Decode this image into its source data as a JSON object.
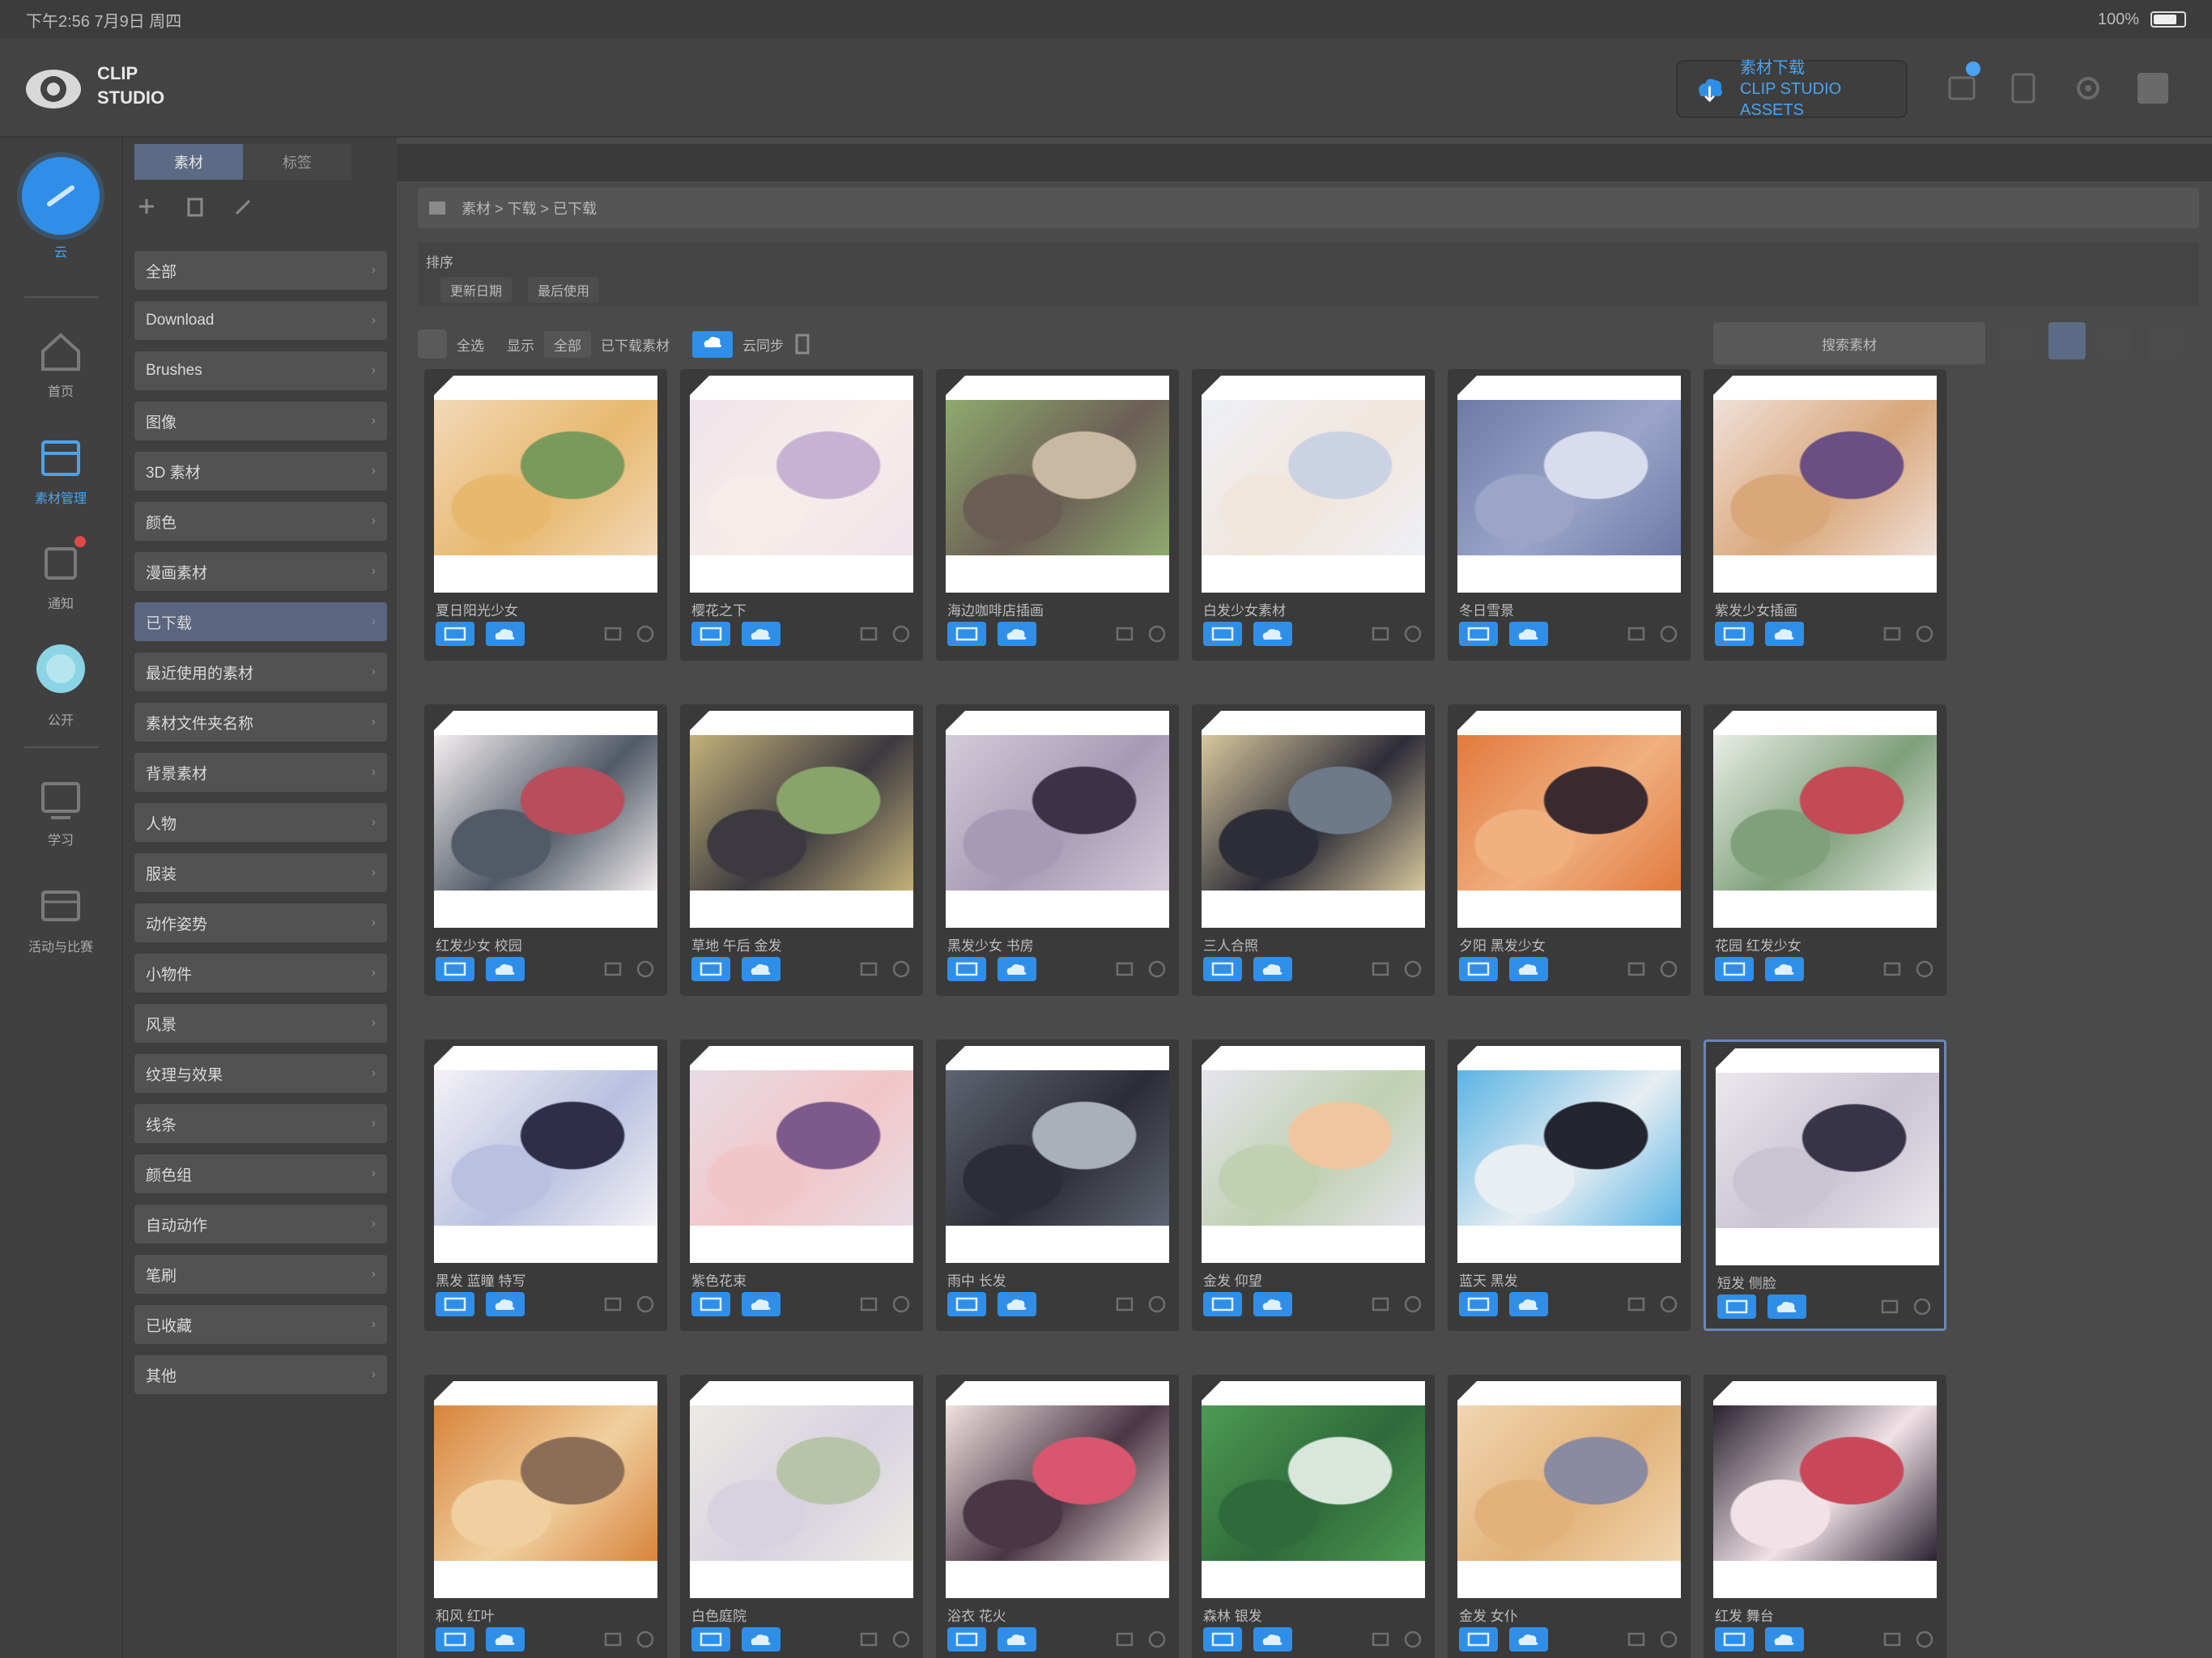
{
  "status_bar": {
    "left_text": "下午2:56 7月9日 周四",
    "right_text": "100%"
  },
  "header": {
    "logo_line1": "CLIP",
    "logo_line2": "STUDIO",
    "download_button": {
      "line1": "素材下载",
      "line2": "CLIP STUDIO ASSETS"
    }
  },
  "rail": {
    "items": [
      {
        "label": "云",
        "icon": "cloud-icon",
        "active": true
      },
      {
        "label": "首页",
        "icon": "home-icon",
        "active": false
      },
      {
        "label": "素材管理",
        "icon": "assets-icon",
        "active": true
      },
      {
        "label": "通知",
        "icon": "notification-icon",
        "active": false
      },
      {
        "label": "公开",
        "icon": "share-icon",
        "active": false
      },
      {
        "label": "学习",
        "icon": "learn-icon",
        "active": false
      },
      {
        "label": "活动与比赛",
        "icon": "event-icon",
        "active": false
      }
    ]
  },
  "category_panel": {
    "tabs": [
      "素材",
      "标签"
    ],
    "items": [
      "全部",
      "Download",
      "Brushes",
      "图像",
      "3D 素材",
      "颜色",
      "漫画素材",
      "已下载",
      "最近使用的素材",
      "素材文件夹名称",
      "背景素材",
      "人物",
      "服装",
      "动作姿势",
      "小物件",
      "风景",
      "纹理与效果",
      "线条",
      "颜色组",
      "自动动作",
      "笔刷",
      "已收藏",
      "其他"
    ],
    "selected_index": 7
  },
  "pathbar": {
    "text": "素材 > 下载 > 已下载"
  },
  "sortbar": {
    "label": "排序",
    "chips": [
      "更新日期",
      "最后使用"
    ]
  },
  "toolbar": {
    "select_all": "全选",
    "items": [
      "显示",
      "全部",
      "已下载素材"
    ],
    "cloud_label": "云同步",
    "search_placeholder": "搜索素材"
  },
  "cards": [
    {
      "title": "夏日阳光少女",
      "palette": [
        "#f2d9b8",
        "#7a9a5c",
        "#e8b86e"
      ]
    },
    {
      "title": "樱花之下",
      "palette": [
        "#efe4ea",
        "#c7b2d4",
        "#f6ece9"
      ]
    },
    {
      "title": "海边咖啡店插画",
      "palette": [
        "#8faa6e",
        "#c9b8a2",
        "#6b5f55"
      ]
    },
    {
      "title": "白发少女素材",
      "palette": [
        "#eef0f6",
        "#cbd2e4",
        "#f1e6dc"
      ]
    },
    {
      "title": "冬日雪景",
      "palette": [
        "#6c7aa6",
        "#d8dcec",
        "#9aa5c8"
      ]
    },
    {
      "title": "紫发少女插画",
      "palette": [
        "#f0e0d8",
        "#6b4f82",
        "#d9a77a"
      ]
    },
    {
      "title": "红发少女 校园",
      "palette": [
        "#f4eff0",
        "#b84d5c",
        "#515a66"
      ]
    },
    {
      "title": "草地 午后 金发",
      "palette": [
        "#c4b27a",
        "#88a46a",
        "#3c3a40"
      ]
    },
    {
      "title": "黑发少女 书房",
      "palette": [
        "#d3ccd8",
        "#3b3248",
        "#a79ab6"
      ]
    },
    {
      "title": "三人合照",
      "palette": [
        "#d8c89e",
        "#6e7a8a",
        "#2d2d38"
      ]
    },
    {
      "title": "夕阳 黑发少女",
      "palette": [
        "#e27a3e",
        "#3a2a30",
        "#f0b080"
      ]
    },
    {
      "title": "花园 红发少女",
      "palette": [
        "#e8ede6",
        "#c44a56",
        "#7fa07a"
      ]
    },
    {
      "title": "黑发 蓝瞳 特写",
      "palette": [
        "#f4f2f6",
        "#2e2e48",
        "#b9c0e0"
      ]
    },
    {
      "title": "紫色花束",
      "palette": [
        "#e8dce4",
        "#7e5a8c",
        "#f1c6c9"
      ]
    },
    {
      "title": "雨中 长发",
      "palette": [
        "#5e6470",
        "#aab0b8",
        "#2c2d36"
      ]
    },
    {
      "title": "金发 仰望",
      "palette": [
        "#e6e4ee",
        "#f0c6a0",
        "#c0d0b0"
      ]
    },
    {
      "title": "蓝天 黑发",
      "palette": [
        "#5ab4e4",
        "#232630",
        "#e8eef2"
      ]
    },
    {
      "title": "短发 侧脸",
      "palette": [
        "#eae8ec",
        "#383448",
        "#c9c3d2"
      ]
    },
    {
      "title": "和风 红叶",
      "palette": [
        "#d8843c",
        "#8c6e58",
        "#f0d0a0"
      ]
    },
    {
      "title": "白色庭院",
      "palette": [
        "#ecebe4",
        "#b8c4a8",
        "#d8d2e0"
      ]
    },
    {
      "title": "浴衣 花火",
      "palette": [
        "#f0e2e0",
        "#d9566e",
        "#4a3644"
      ]
    },
    {
      "title": "森林 银发",
      "palette": [
        "#4e9a54",
        "#d8e6dc",
        "#2e6a3a"
      ]
    },
    {
      "title": "金发 女仆",
      "palette": [
        "#f0d6b0",
        "#8a8aa0",
        "#e2b27a"
      ]
    },
    {
      "title": "红发 舞台",
      "palette": [
        "#2a2230",
        "#c8485a",
        "#f0e2e6"
      ]
    }
  ],
  "selected_card_index": 17,
  "colors": {
    "accent": "#2f8fe8",
    "selection": "#5b6b85"
  }
}
